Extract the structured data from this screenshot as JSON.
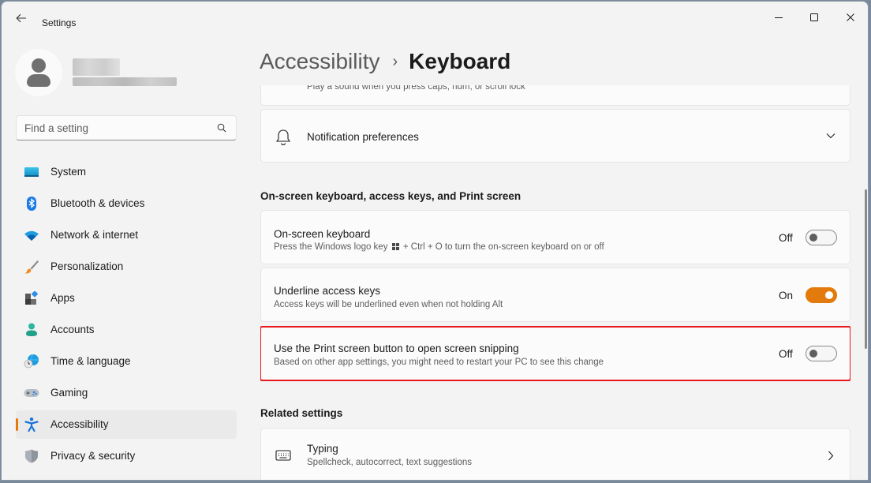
{
  "window": {
    "title": "Settings",
    "controls": {
      "minimize": "minimize",
      "maximize": "maximize",
      "close": "close"
    }
  },
  "profile": {
    "name": "",
    "email": ""
  },
  "search": {
    "placeholder": "Find a setting",
    "value": ""
  },
  "sidebar": {
    "items": [
      {
        "label": "System",
        "icon": "system-icon",
        "active": false
      },
      {
        "label": "Bluetooth & devices",
        "icon": "bluetooth-icon",
        "active": false
      },
      {
        "label": "Network & internet",
        "icon": "wifi-icon",
        "active": false
      },
      {
        "label": "Personalization",
        "icon": "paintbrush-icon",
        "active": false
      },
      {
        "label": "Apps",
        "icon": "apps-icon",
        "active": false
      },
      {
        "label": "Accounts",
        "icon": "accounts-icon",
        "active": false
      },
      {
        "label": "Time & language",
        "icon": "globe-clock-icon",
        "active": false
      },
      {
        "label": "Gaming",
        "icon": "gamepad-icon",
        "active": false
      },
      {
        "label": "Accessibility",
        "icon": "accessibility-icon",
        "active": true
      },
      {
        "label": "Privacy & security",
        "icon": "shield-icon",
        "active": false
      }
    ]
  },
  "breadcrumb": {
    "parent": "Accessibility",
    "separator": "›",
    "current": "Keyboard"
  },
  "main": {
    "partial_card": {
      "description": "Play a sound when you press caps, num, or scroll lock"
    },
    "notification_card": {
      "title": "Notification preferences",
      "icon": "bell-icon"
    },
    "section1": {
      "heading": "On-screen keyboard, access keys, and Print screen",
      "items": [
        {
          "title": "On-screen keyboard",
          "description_pre": "Press the Windows logo key",
          "description_post": "+ Ctrl + O to turn the on-screen keyboard on or off",
          "state_label": "Off",
          "on": false
        },
        {
          "title": "Underline access keys",
          "description": "Access keys will be underlined even when not holding Alt",
          "state_label": "On",
          "on": true
        },
        {
          "title": "Use the Print screen button to open screen snipping",
          "description": "Based on other app settings, you might need to restart your PC to see this change",
          "state_label": "Off",
          "on": false,
          "highlighted": true
        }
      ]
    },
    "related": {
      "heading": "Related settings",
      "items": [
        {
          "title": "Typing",
          "description": "Spellcheck, autocorrect, text suggestions",
          "icon": "keyboard-icon"
        }
      ]
    }
  },
  "colors": {
    "accent": "#e37a0c",
    "highlight_border": "#e8191b",
    "background": "#f3f3f3",
    "card": "#fbfbfb"
  }
}
